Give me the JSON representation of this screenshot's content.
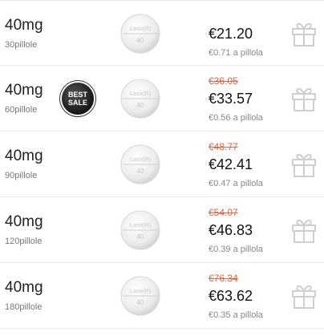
{
  "offers": [
    {
      "dose": "40mg",
      "count": "30pillole",
      "old_price": "",
      "price": "€21.20",
      "per_unit": "€0.71 a pillola",
      "badge": false,
      "pill_imprint": [
        "Lasix(R)",
        "40"
      ],
      "gift_icon": "gift-icon"
    },
    {
      "dose": "40mg",
      "count": "60pillole",
      "old_price": "€36.05",
      "price": "€33.57",
      "per_unit": "€0.56 a pillola",
      "badge": true,
      "badge_lines": [
        "BEST",
        "SALE"
      ],
      "pill_imprint": [
        "Lasix(R)",
        "40"
      ],
      "gift_icon": "gift-icon"
    },
    {
      "dose": "40mg",
      "count": "90pillole",
      "old_price": "€48.77",
      "price": "€42.41",
      "per_unit": "€0.47 a pillola",
      "badge": false,
      "pill_imprint": [
        "Lasix(R)",
        "40"
      ],
      "gift_icon": "gift-icon"
    },
    {
      "dose": "40mg",
      "count": "120pillole",
      "old_price": "€54.07",
      "price": "€46.83",
      "per_unit": "€0.39 a pillola",
      "badge": false,
      "pill_imprint": [
        "Lasix(R)",
        "40"
      ],
      "gift_icon": "gift-icon"
    },
    {
      "dose": "40mg",
      "count": "180pillole",
      "old_price": "€76.34",
      "price": "€63.62",
      "per_unit": "€0.35 a pillola",
      "badge": false,
      "pill_imprint": [
        "Lasix(R)",
        "40"
      ],
      "gift_icon": "gift-icon"
    }
  ],
  "colors": {
    "old_price": "#e8603c",
    "badge_bg": "#1a1a1a",
    "icon": "#cfcfcf"
  }
}
